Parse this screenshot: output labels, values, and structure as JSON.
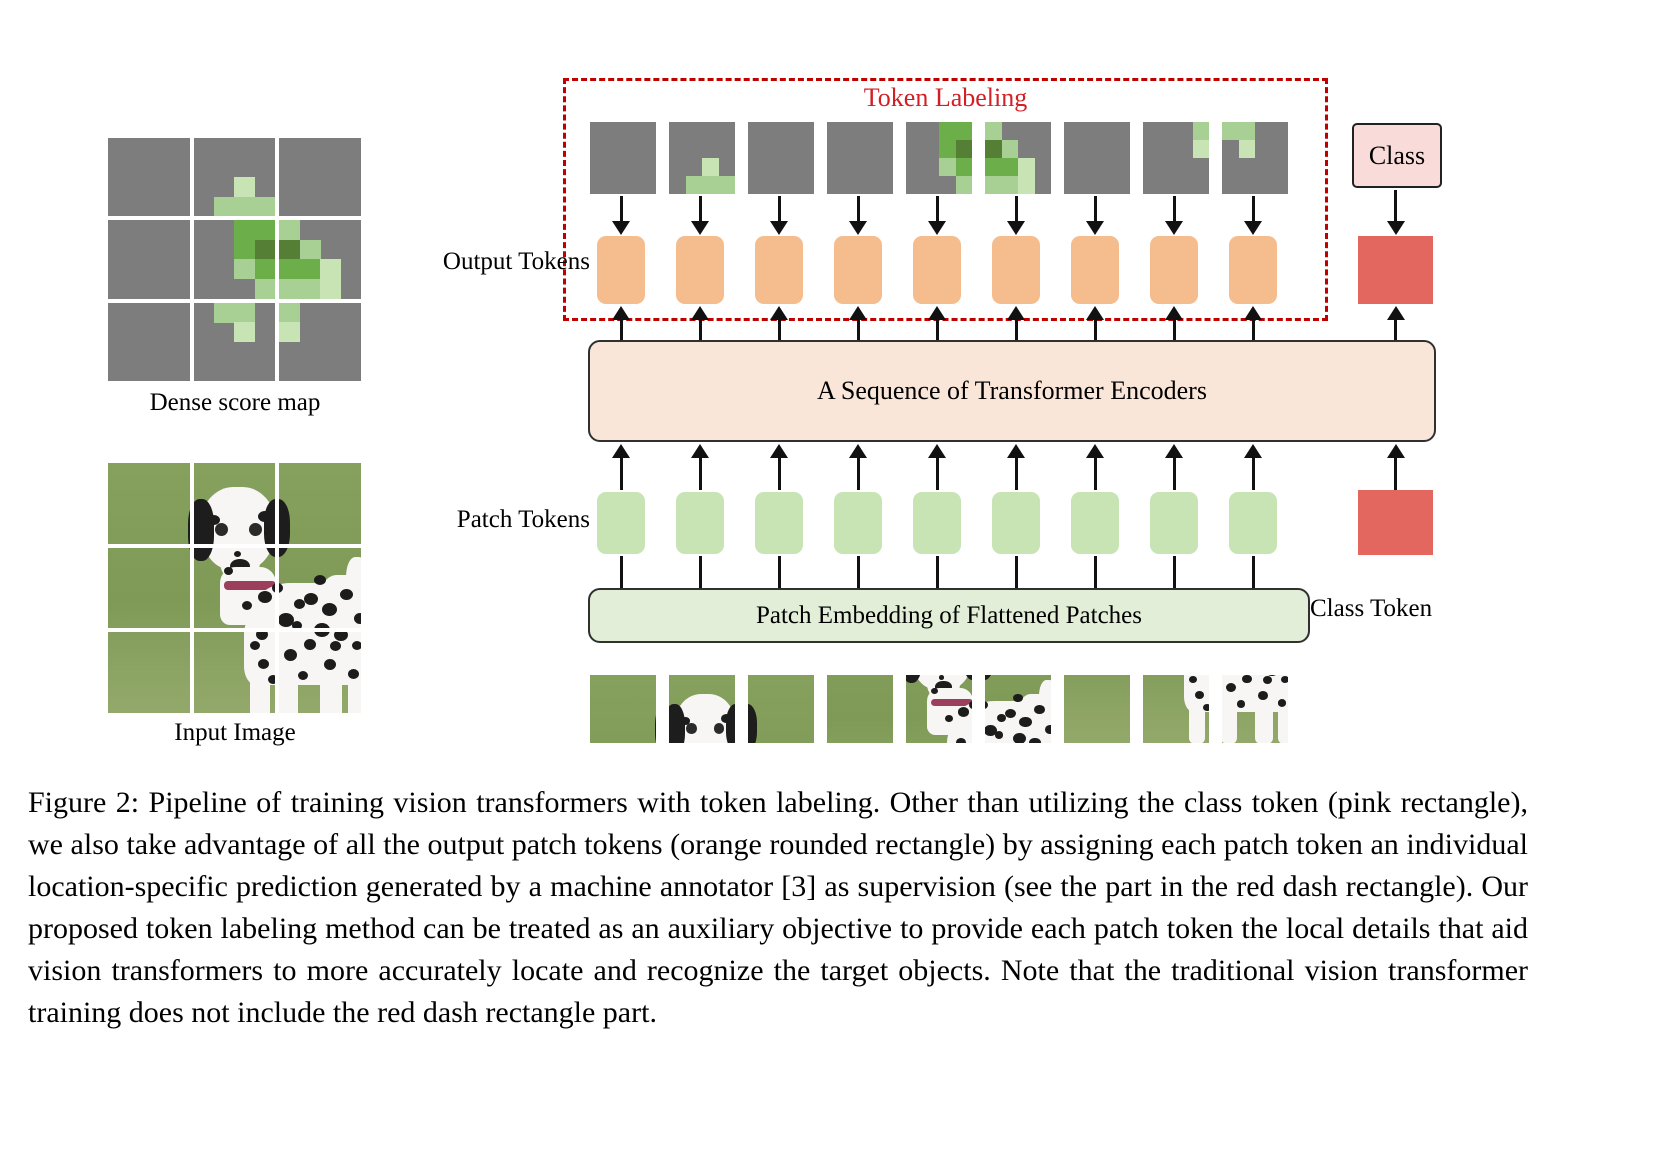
{
  "figure": {
    "number": "Figure 2",
    "caption": "Figure 2:  Pipeline of training vision transformers with token labeling.  Other than utilizing the class token (pink rectangle), we also take advantage of all the output patch tokens (orange rounded rectangle) by assigning each patch token an individual location-specific prediction generated by a machine annotator [3] as supervision (see the part in the red dash rectangle).  Our proposed token labeling method can be treated as an auxiliary objective to provide each patch token the local details that aid vision transformers to more accurately locate and recognize the target objects.  Note that the traditional vision transformer training does not include the red dash rectangle part."
  },
  "labels": {
    "dense_score_map": "Dense score map",
    "input_image": "Input Image",
    "output_tokens": "Output Tokens",
    "patch_tokens": "Patch Tokens",
    "class_token": "Class Token",
    "token_labeling": "Token Labeling",
    "class_box": "Class",
    "encoder_box": "A Sequence of Transformer Encoders",
    "embedding_box": "Patch Embedding of Flattened Patches"
  },
  "colors": {
    "background_gray": "#7d7d7d",
    "green_dark": "#547f35",
    "green_mid": "#6cae4a",
    "green_light": "#a9d094",
    "green_pale": "#c8e3b4",
    "token_orange": "#f5bd8e",
    "token_green": "#c8e3b4",
    "class_token_red": "#e3675f",
    "class_box_pink": "#f9dcd9",
    "encoder_peach": "#fae6d9",
    "embedding_green": "#e2eed7",
    "dashed_red": "#c00000",
    "title_red": "#d21f26",
    "arrow_black": "#111111"
  },
  "dense_score_map": {
    "grid": [
      3,
      3
    ],
    "subgrid": [
      4,
      4
    ],
    "cells": [
      {
        "index": 0,
        "pixels": []
      },
      {
        "index": 1,
        "pixels": [
          {
            "r": 2,
            "c": 2,
            "v": "green_pale"
          },
          {
            "r": 3,
            "c": 1,
            "v": "green_light"
          },
          {
            "r": 3,
            "c": 2,
            "v": "green_light"
          },
          {
            "r": 3,
            "c": 3,
            "v": "green_light"
          }
        ]
      },
      {
        "index": 2,
        "pixels": []
      },
      {
        "index": 3,
        "pixels": []
      },
      {
        "index": 4,
        "pixels": [
          {
            "r": 0,
            "c": 2,
            "v": "green_mid"
          },
          {
            "r": 0,
            "c": 3,
            "v": "green_mid"
          },
          {
            "r": 1,
            "c": 2,
            "v": "green_mid"
          },
          {
            "r": 1,
            "c": 3,
            "v": "green_dark"
          },
          {
            "r": 2,
            "c": 2,
            "v": "green_light"
          },
          {
            "r": 2,
            "c": 3,
            "v": "green_mid"
          },
          {
            "r": 3,
            "c": 3,
            "v": "green_light"
          }
        ]
      },
      {
        "index": 5,
        "pixels": [
          {
            "r": 0,
            "c": 0,
            "v": "green_light"
          },
          {
            "r": 1,
            "c": 0,
            "v": "green_dark"
          },
          {
            "r": 1,
            "c": 1,
            "v": "green_light"
          },
          {
            "r": 2,
            "c": 0,
            "v": "green_mid"
          },
          {
            "r": 2,
            "c": 1,
            "v": "green_mid"
          },
          {
            "r": 2,
            "c": 2,
            "v": "green_pale"
          },
          {
            "r": 3,
            "c": 0,
            "v": "green_light"
          },
          {
            "r": 3,
            "c": 1,
            "v": "green_light"
          },
          {
            "r": 3,
            "c": 2,
            "v": "green_pale"
          }
        ]
      },
      {
        "index": 6,
        "pixels": []
      },
      {
        "index": 7,
        "pixels": [
          {
            "r": 0,
            "c": 1,
            "v": "green_light"
          },
          {
            "r": 0,
            "c": 2,
            "v": "green_light"
          },
          {
            "r": 1,
            "c": 2,
            "v": "green_pale"
          }
        ]
      },
      {
        "index": 8,
        "pixels": [
          {
            "r": 0,
            "c": 0,
            "v": "green_light"
          },
          {
            "r": 1,
            "c": 0,
            "v": "green_pale"
          }
        ]
      }
    ]
  },
  "token_labeling_patches": [
    {
      "index": 0,
      "pixels": []
    },
    {
      "index": 1,
      "pixels": [
        {
          "r": 2,
          "c": 2,
          "v": "green_pale"
        },
        {
          "r": 3,
          "c": 1,
          "v": "green_light"
        },
        {
          "r": 3,
          "c": 2,
          "v": "green_light"
        },
        {
          "r": 3,
          "c": 3,
          "v": "green_light"
        }
      ]
    },
    {
      "index": 2,
      "pixels": []
    },
    {
      "index": 3,
      "pixels": []
    },
    {
      "index": 4,
      "pixels": [
        {
          "r": 0,
          "c": 2,
          "v": "green_mid"
        },
        {
          "r": 0,
          "c": 3,
          "v": "green_mid"
        },
        {
          "r": 1,
          "c": 2,
          "v": "green_mid"
        },
        {
          "r": 1,
          "c": 3,
          "v": "green_dark"
        },
        {
          "r": 2,
          "c": 2,
          "v": "green_light"
        },
        {
          "r": 2,
          "c": 3,
          "v": "green_mid"
        },
        {
          "r": 3,
          "c": 3,
          "v": "green_light"
        }
      ]
    },
    {
      "index": 5,
      "pixels": [
        {
          "r": 0,
          "c": 0,
          "v": "green_light"
        },
        {
          "r": 1,
          "c": 0,
          "v": "green_dark"
        },
        {
          "r": 1,
          "c": 1,
          "v": "green_light"
        },
        {
          "r": 2,
          "c": 0,
          "v": "green_mid"
        },
        {
          "r": 2,
          "c": 1,
          "v": "green_mid"
        },
        {
          "r": 2,
          "c": 2,
          "v": "green_pale"
        },
        {
          "r": 3,
          "c": 0,
          "v": "green_light"
        },
        {
          "r": 3,
          "c": 1,
          "v": "green_light"
        },
        {
          "r": 3,
          "c": 2,
          "v": "green_pale"
        }
      ]
    },
    {
      "index": 6,
      "pixels": []
    },
    {
      "index": 7,
      "pixels": [
        {
          "r": 0,
          "c": 3,
          "v": "green_light"
        },
        {
          "r": 1,
          "c": 3,
          "v": "green_pale"
        }
      ]
    },
    {
      "index": 8,
      "pixels": [
        {
          "r": 0,
          "c": 0,
          "v": "green_light"
        },
        {
          "r": 0,
          "c": 1,
          "v": "green_light"
        },
        {
          "r": 1,
          "c": 1,
          "v": "green_pale"
        }
      ]
    }
  ],
  "output_tokens": {
    "count": 9
  },
  "patch_tokens": {
    "count": 9
  },
  "image_patches": {
    "count": 9,
    "content": [
      "grass",
      "dog-head",
      "grass",
      "grass",
      "dog-neck",
      "dog-body",
      "grass",
      "dog-legs",
      "dog-hind"
    ]
  }
}
